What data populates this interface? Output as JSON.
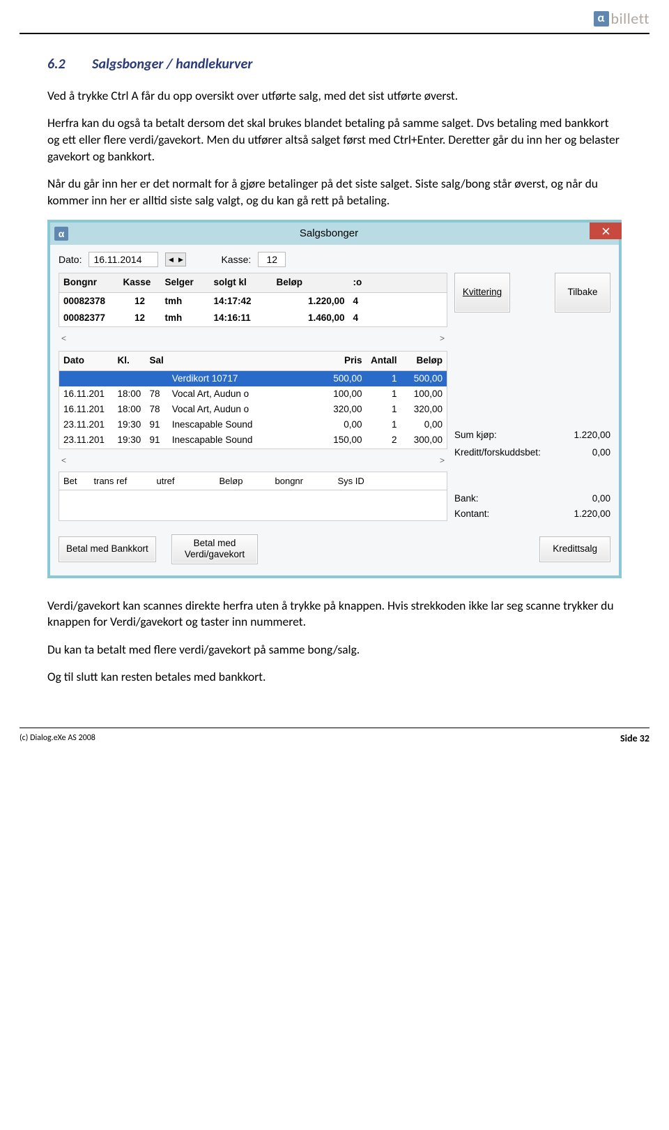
{
  "header": {
    "logo_text": "billett",
    "logo_alpha": "α"
  },
  "section": {
    "number": "6.2",
    "title": "Salgsbonger / handlekurver"
  },
  "paragraphs": {
    "p1": "Ved å trykke Ctrl A får du opp oversikt over utførte salg, med det sist utførte øverst.",
    "p2": "Herfra kan du også ta betalt dersom det skal brukes blandet betaling på samme salget. Dvs betaling med bankkort og ett eller flere verdi/gavekort. Men du utfører altså salget først med Ctrl+Enter. Deretter går du inn her og belaster gavekort og bankkort.",
    "p3": "Når du går inn her er det normalt for å gjøre betalinger på det siste salget. Siste salg/bong står øverst, og når du kommer inn her er alltid siste salg valgt, og du kan gå rett på betaling.",
    "p4": "Verdi/gavekort kan scannes direkte herfra uten å trykke på knappen. Hvis strekkoden ikke lar seg scanne trykker du knappen for Verdi/gavekort og taster inn nummeret.",
    "p5": "Du kan ta betalt med flere verdi/gavekort på samme bong/salg.",
    "p6": "Og til slutt kan resten betales med bankkort."
  },
  "window": {
    "title": "Salgsbonger",
    "top": {
      "dato_label": "Dato:",
      "dato_value": "16.11.2014",
      "kasse_label": "Kasse:",
      "kasse_value": "12"
    },
    "buttons": {
      "kvittering": "Kvittering",
      "tilbake": "Tilbake",
      "betal_bank": "Betal med Bankkort",
      "betal_verdi": "Betal med Verdi/gavekort",
      "kredittsalg": "Kredittsalg"
    },
    "t1": {
      "headers": [
        "Bongnr",
        "Kasse",
        "Selger",
        "solgt kl",
        "Beløp",
        ":o"
      ],
      "rows": [
        [
          "00082378",
          "12",
          "tmh",
          "14:17:42",
          "1.220,00",
          "4"
        ],
        [
          "00082377",
          "12",
          "tmh",
          "14:16:11",
          "1.460,00",
          "4"
        ]
      ]
    },
    "t2": {
      "headers": [
        "Dato",
        "Kl.",
        "Sal",
        "",
        "Pris",
        "Antall",
        "Beløp"
      ],
      "rows": [
        [
          "",
          "",
          "",
          "Verdikort 10717",
          "500,00",
          "1",
          "500,00"
        ],
        [
          "16.11.201",
          "18:00",
          "78",
          "Vocal Art, Audun o",
          "100,00",
          "1",
          "100,00"
        ],
        [
          "16.11.201",
          "18:00",
          "78",
          "Vocal Art, Audun o",
          "320,00",
          "1",
          "320,00"
        ],
        [
          "23.11.201",
          "19:30",
          "91",
          "Inescapable Sound",
          "0,00",
          "1",
          "0,00"
        ],
        [
          "23.11.201",
          "19:30",
          "91",
          "Inescapable Sound",
          "150,00",
          "2",
          "300,00"
        ]
      ]
    },
    "sums": {
      "sum_label": "Sum kjøp:",
      "sum_value": "1.220,00",
      "kreditt_label": "Kreditt/forskuddsbet:",
      "kreditt_value": "0,00",
      "bank_label": "Bank:",
      "bank_value": "0,00",
      "kontant_label": "Kontant:",
      "kontant_value": "1.220,00"
    },
    "t3": {
      "headers": [
        "Bet",
        "trans ref",
        "utref",
        "Beløp",
        "bongnr",
        "Sys ID"
      ]
    }
  },
  "footer": {
    "copyright": "(c) Dialog.eXe AS 2008",
    "page": "Side 32"
  }
}
